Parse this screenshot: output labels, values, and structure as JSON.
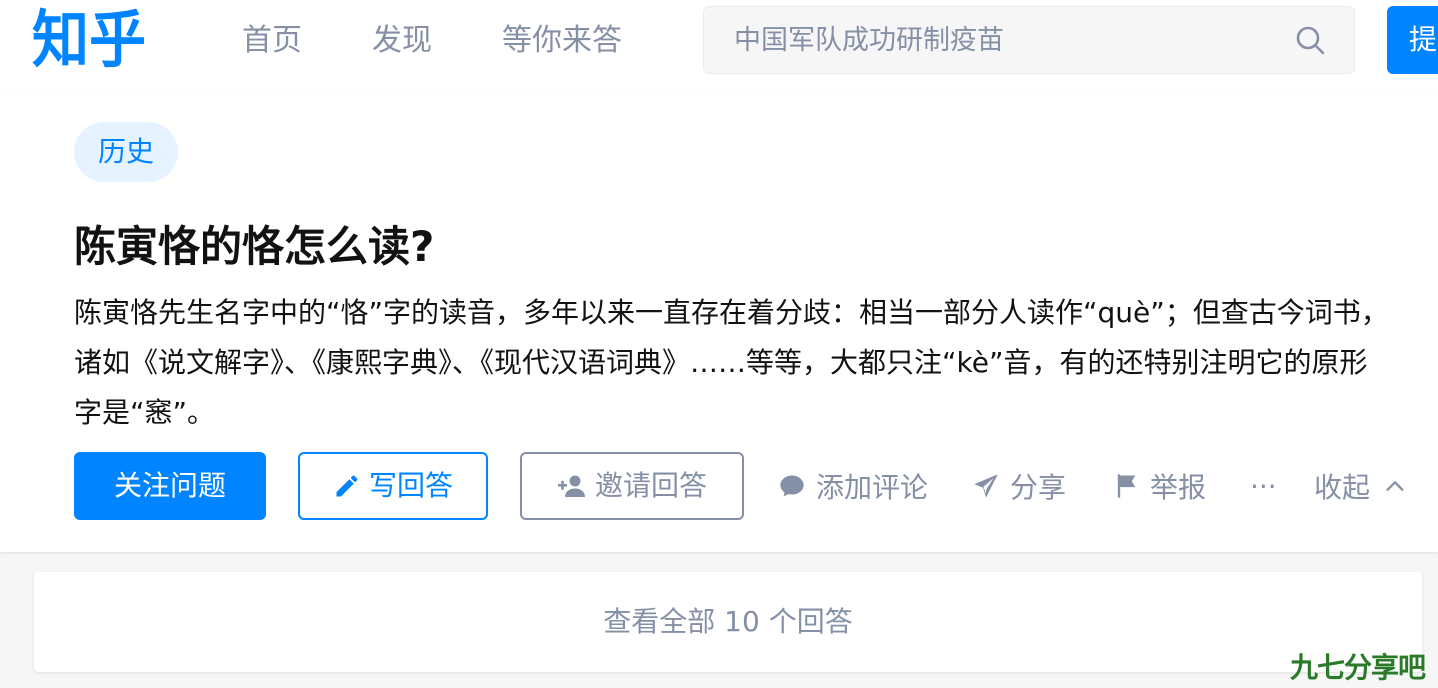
{
  "header": {
    "logo": "知乎",
    "nav": [
      "首页",
      "发现",
      "等你来答"
    ],
    "search": {
      "placeholder": "中国军队成功研制疫苗"
    },
    "ask_label": "提问"
  },
  "question": {
    "topic": "历史",
    "title": "陈寅恪的恪怎么读?",
    "description": "陈寅恪先生名字中的“恪”字的读音，多年以来一直存在着分歧：相当一部分人读作“què”；但查古今词书，诸如《说文解字》、《康熙字典》、《现代汉语词典》……等等，大都只注“kè”音，有的还特别注明它的原形字是“窸”。",
    "actions": {
      "follow": "关注问题",
      "write": "写回答",
      "invite": "邀请回答",
      "comment": "添加评论",
      "share": "分享",
      "report": "举报",
      "more": "···",
      "collapse": "收起"
    }
  },
  "answers": {
    "view_all": "查看全部 10 个回答"
  },
  "watermark": "九七分享吧",
  "colors": {
    "brand": "#0084ff",
    "muted": "#8590a6",
    "tag_bg": "#e5f2ff"
  },
  "icons": [
    "search-icon",
    "pencil-icon",
    "add-user-icon",
    "comment-icon",
    "paper-plane-icon",
    "flag-icon",
    "chevron-up-icon"
  ]
}
